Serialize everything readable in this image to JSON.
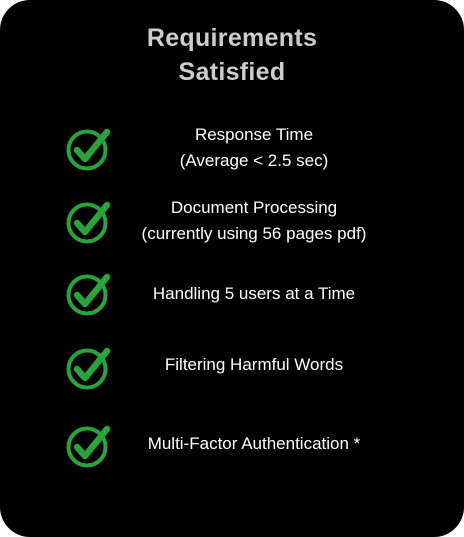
{
  "title": {
    "line1": "Requirements",
    "line2": "Satisfied"
  },
  "colors": {
    "background": "#000000",
    "title": "#cdcdcd",
    "text": "#ffffff",
    "check": "#26a53b"
  },
  "items": [
    {
      "icon": "check-circle-icon",
      "line1": "Response Time",
      "line2": "(Average < 2.5 sec)"
    },
    {
      "icon": "check-circle-icon",
      "line1": "Document Processing",
      "line2": "(currently using 56 pages pdf)"
    },
    {
      "icon": "check-circle-icon",
      "line1": "Handling 5 users at a Time"
    },
    {
      "icon": "check-circle-icon",
      "line1": "Filtering Harmful Words"
    },
    {
      "icon": "check-circle-icon",
      "line1": "Multi-Factor Authentication *"
    }
  ]
}
